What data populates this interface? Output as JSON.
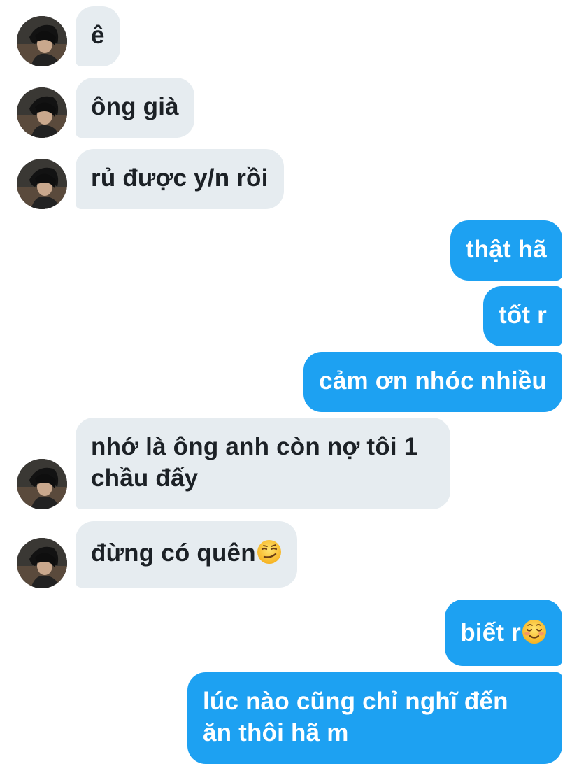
{
  "conversation": {
    "messages": [
      {
        "from": "them",
        "text": "ê"
      },
      {
        "from": "them",
        "text": "ông già"
      },
      {
        "from": "them",
        "text": "rủ được y/n rồi"
      },
      {
        "from": "me",
        "text": "thật hã"
      },
      {
        "from": "me",
        "text": "tốt r"
      },
      {
        "from": "me",
        "text": "cảm ơn nhóc nhiều"
      },
      {
        "from": "them",
        "line1": "nhớ là ông anh còn nợ tôi 1",
        "line2": "chầu đấy"
      },
      {
        "from": "them",
        "text": "đừng có quên",
        "emoji": "smirk-emoji"
      },
      {
        "from": "me",
        "text": "biết r",
        "emoji": "smiling-blush-emoji"
      },
      {
        "from": "me",
        "line1": "lúc nào cũng chỉ nghĩ đến",
        "line2": "ăn thôi hã m"
      }
    ]
  },
  "colors": {
    "incoming_bubble": "#e6ecf0",
    "outgoing_bubble": "#1da1f2",
    "incoming_text": "#1c2126",
    "outgoing_text": "#ffffff"
  },
  "icons": {
    "avatar": "profile-photo-avatar"
  }
}
